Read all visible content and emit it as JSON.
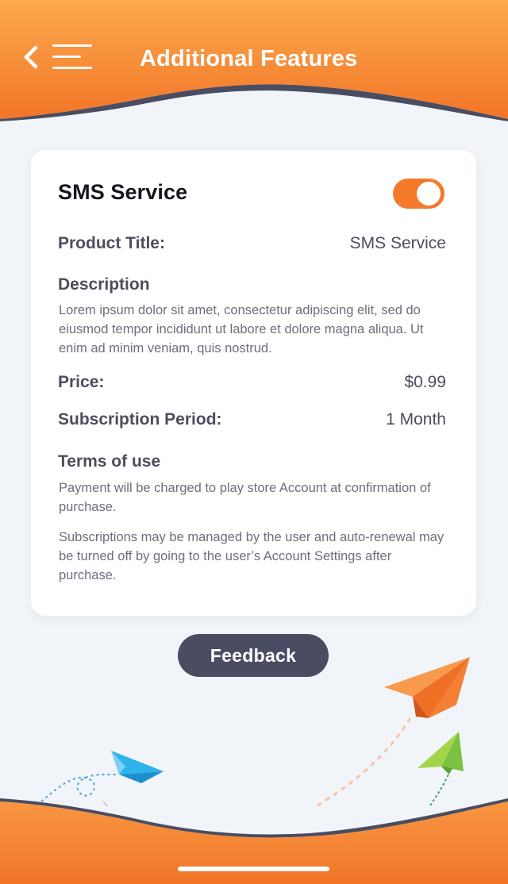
{
  "header": {
    "title": "Additional Features"
  },
  "icons": {
    "back": "chevron-left-icon",
    "menu": "hamburger-menu-icon"
  },
  "colors": {
    "accent_orange": "#f47a2a",
    "header_gradient_top": "#fcaa4e",
    "header_gradient_bottom": "#f27528",
    "wave_dark": "#4a4d61",
    "button_dark": "#4a4d61",
    "background": "#f1f4f8",
    "card": "#ffffff"
  },
  "card": {
    "title": "SMS Service",
    "toggle_on": true,
    "product_title_label": "Product Title:",
    "product_title_value": "SMS Service",
    "description_heading": "Description",
    "description_text": "Lorem ipsum dolor sit amet, consectetur adipiscing elit, sed do eiusmod tempor incididunt ut labore et dolore magna aliqua. Ut enim ad minim veniam, quis nostrud.",
    "price_label": "Price:",
    "price_value": "$0.99",
    "subscription_label": "Subscription Period:",
    "subscription_value": "1 Month",
    "terms_heading": "Terms of use",
    "terms_text_1": "Payment will be charged to play store Account at confirmation of purchase.",
    "terms_text_2": "Subscriptions may be managed by the user and auto-renewal may be turned off by going to the user’s Account Settings after purchase."
  },
  "feedback_button": {
    "label": "Feedback"
  }
}
